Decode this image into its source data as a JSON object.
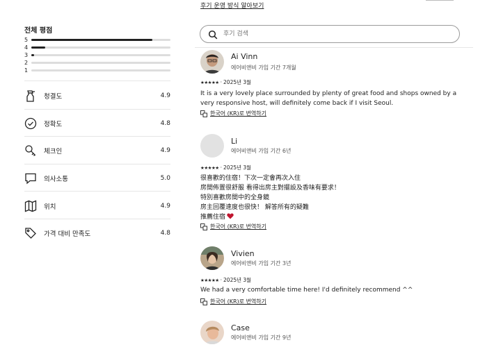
{
  "header": {
    "link": "후기 운영 방식 알아보기"
  },
  "overall": {
    "title": "전체 평점",
    "bars": [
      {
        "label": "5",
        "fill": 0.87
      },
      {
        "label": "4",
        "fill": 0.1
      },
      {
        "label": "3",
        "fill": 0.02
      },
      {
        "label": "2",
        "fill": 0.0
      },
      {
        "label": "1",
        "fill": 0.0
      }
    ]
  },
  "categories": [
    {
      "label": "청결도",
      "score": "4.9",
      "icon": "spray-bottle-icon"
    },
    {
      "label": "정확도",
      "score": "4.8",
      "icon": "check-circle-icon"
    },
    {
      "label": "체크인",
      "score": "4.9",
      "icon": "key-icon"
    },
    {
      "label": "의사소통",
      "score": "5.0",
      "icon": "message-icon"
    },
    {
      "label": "위치",
      "score": "4.9",
      "icon": "map-icon"
    },
    {
      "label": "가격 대비 만족도",
      "score": "4.8",
      "icon": "tag-icon"
    }
  ],
  "search": {
    "placeholder": "후기 검색"
  },
  "reviews": [
    {
      "name": "Ai Vinn",
      "meta": "에어비앤비 가입 기간 7개월",
      "stars": "★★★★★",
      "date": "2025년 3월",
      "lines": [
        "It is a very lovely place surrounded by plenty of great food and shops owned by a",
        "very responsive host, will definitely come back if I visit Seoul."
      ],
      "translate": "한국어 (KR)로 번역하기"
    },
    {
      "name": "Li",
      "meta": "에어비앤비 가입 기간 6년",
      "stars": "★★★★★",
      "date": "2025년 3월",
      "lines": [
        "很喜歡的住宿！下次一定會再次入住",
        "房間佈置很舒服 看得出房主對擺設及香味有要求！",
        "特別喜歡房間中的全身鏡",
        "房主回覆速度也很快！ 解答所有的疑難",
        "推薦住宿"
      ],
      "translate": "한국어 (KR)로 번역하기"
    },
    {
      "name": "Vivien",
      "meta": "에어비앤비 가입 기간 3년",
      "stars": "★★★★★",
      "date": "2025년 3월",
      "lines": [
        "We had a very comfortable time here! I'd definitely recommend ^^"
      ],
      "translate": "한국어 (KR)로 번역하기"
    },
    {
      "name": "Case",
      "meta": "에어비앤비 가입 기간 9년"
    }
  ],
  "colors": {
    "heart": "#c0152f",
    "text": "#222222",
    "muted": "#717171"
  }
}
